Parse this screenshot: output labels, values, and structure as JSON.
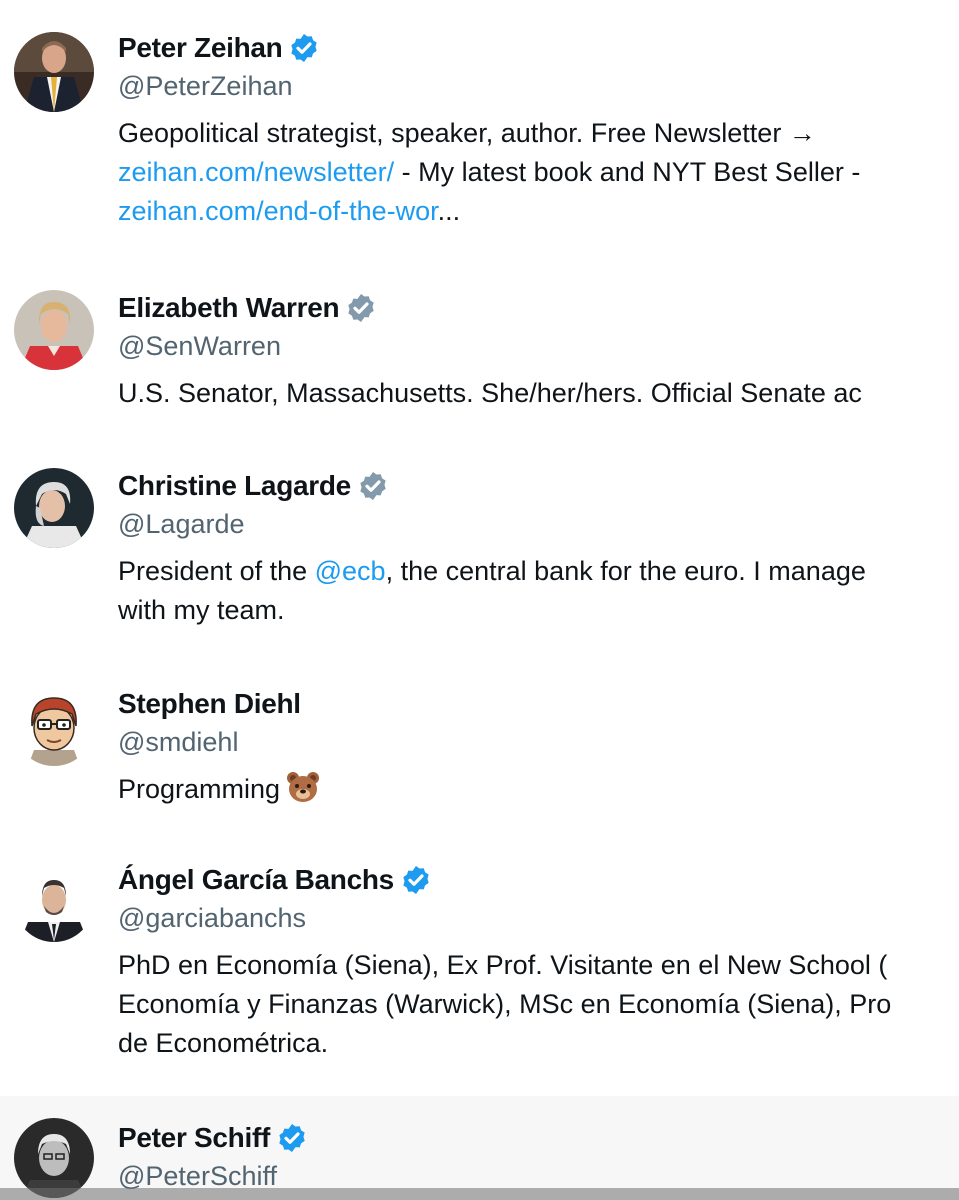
{
  "users": [
    {
      "name": "Peter Zeihan",
      "handle": "@PeterZeihan",
      "verified": "blue",
      "bio_lines": [
        [
          {
            "text": "Geopolitical strategist, speaker, author. Free Newsletter →"
          }
        ],
        [
          {
            "text": "zeihan.com/newsletter/",
            "link": true
          },
          {
            "text": " - My latest book and NYT Best Seller -"
          }
        ],
        [
          {
            "text": "zeihan.com/end-of-the-wor",
            "link": true
          },
          {
            "text": "..."
          }
        ]
      ]
    },
    {
      "name": "Elizabeth Warren",
      "handle": "@SenWarren",
      "verified": "gray",
      "bio_lines": [
        [
          {
            "text": "U.S. Senator, Massachusetts. She/her/hers. Official Senate ac"
          }
        ]
      ]
    },
    {
      "name": "Christine Lagarde",
      "handle": "@Lagarde",
      "verified": "gray",
      "bio_lines": [
        [
          {
            "text": "President of the "
          },
          {
            "text": "@ecb",
            "link": true
          },
          {
            "text": ", the central bank for the euro. I manage"
          }
        ],
        [
          {
            "text": "with my team."
          }
        ]
      ]
    },
    {
      "name": "Stephen Diehl",
      "handle": "@smdiehl",
      "verified": "none",
      "bio_lines": [
        [
          {
            "text": "Programming"
          },
          {
            "emoji": "bear-face-emoji"
          }
        ]
      ]
    },
    {
      "name": "Ángel García Banchs",
      "handle": "@garciabanchs",
      "verified": "blue",
      "bio_lines": [
        [
          {
            "text": "PhD en Economía (Siena), Ex Prof. Visitante en el New School ("
          }
        ],
        [
          {
            "text": "Economía y Finanzas (Warwick), MSc en Economía (Siena), Pro"
          }
        ],
        [
          {
            "text": "de Econométrica."
          }
        ]
      ]
    },
    {
      "name": "Peter Schiff",
      "handle": "@PeterSchiff",
      "verified": "blue",
      "bio_lines": []
    }
  ],
  "colors": {
    "link": "#1d9bf0",
    "verified_blue": "#1d9bf0",
    "verified_gray": "#829aab",
    "secondary_text": "#536471",
    "hover_background": "#f7f7f7"
  },
  "icons": {
    "verified": "verified-badge-icon",
    "bear": "bear-face-emoji"
  }
}
